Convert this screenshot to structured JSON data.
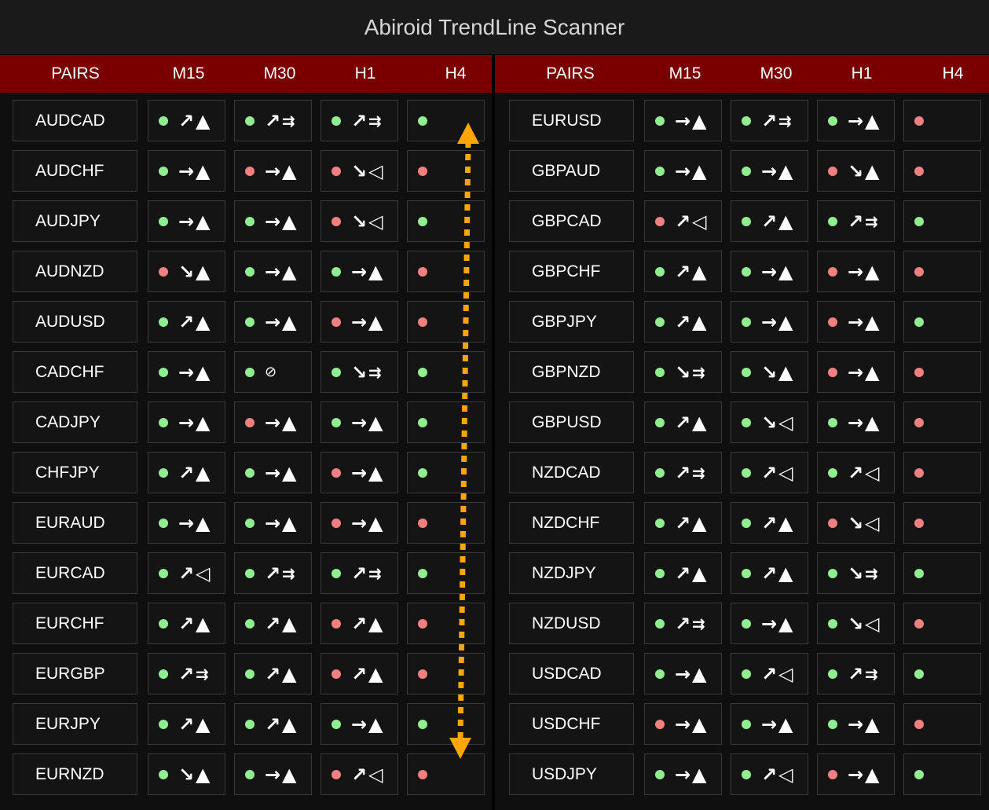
{
  "title": "Abiroid TrendLine Scanner",
  "colors": {
    "bullish": "#90ee90",
    "bearish": "#f08080",
    "header": "#7a0000",
    "annotation_arrow": "#ffa500"
  },
  "glyphs": {
    "up": "↗",
    "right": "→",
    "down": "↘",
    "triangle": "▲",
    "hollow": "◁",
    "double": "⇉",
    "no": "⊘"
  },
  "headers": [
    "PAIRS",
    "M15",
    "M30",
    "H1",
    "H4"
  ],
  "left_table": [
    {
      "pair": "AUDCAD",
      "cells": [
        {
          "dot": "g",
          "arrow": "up",
          "shape": "triangle"
        },
        {
          "dot": "g",
          "arrow": "up",
          "shape": "double"
        },
        {
          "dot": "g",
          "arrow": "up",
          "shape": "double"
        },
        {
          "dot": "g"
        }
      ]
    },
    {
      "pair": "AUDCHF",
      "cells": [
        {
          "dot": "g",
          "arrow": "right",
          "shape": "triangle"
        },
        {
          "dot": "r",
          "arrow": "right",
          "shape": "triangle"
        },
        {
          "dot": "r",
          "arrow": "down",
          "shape": "hollow"
        },
        {
          "dot": "r"
        }
      ]
    },
    {
      "pair": "AUDJPY",
      "cells": [
        {
          "dot": "g",
          "arrow": "right",
          "shape": "triangle"
        },
        {
          "dot": "g",
          "arrow": "right",
          "shape": "triangle"
        },
        {
          "dot": "r",
          "arrow": "down",
          "shape": "hollow"
        },
        {
          "dot": "g"
        }
      ]
    },
    {
      "pair": "AUDNZD",
      "cells": [
        {
          "dot": "r",
          "arrow": "down",
          "shape": "triangle"
        },
        {
          "dot": "g",
          "arrow": "right",
          "shape": "triangle"
        },
        {
          "dot": "g",
          "arrow": "right",
          "shape": "triangle"
        },
        {
          "dot": "r"
        }
      ]
    },
    {
      "pair": "AUDUSD",
      "cells": [
        {
          "dot": "g",
          "arrow": "up",
          "shape": "triangle"
        },
        {
          "dot": "g",
          "arrow": "right",
          "shape": "triangle"
        },
        {
          "dot": "r",
          "arrow": "right",
          "shape": "triangle"
        },
        {
          "dot": "r"
        }
      ]
    },
    {
      "pair": "CADCHF",
      "cells": [
        {
          "dot": "g",
          "arrow": "right",
          "shape": "triangle"
        },
        {
          "dot": "g",
          "arrow": "no",
          "shape": ""
        },
        {
          "dot": "g",
          "arrow": "down",
          "shape": "double"
        },
        {
          "dot": "g"
        }
      ]
    },
    {
      "pair": "CADJPY",
      "cells": [
        {
          "dot": "g",
          "arrow": "right",
          "shape": "triangle"
        },
        {
          "dot": "r",
          "arrow": "right",
          "shape": "triangle"
        },
        {
          "dot": "g",
          "arrow": "right",
          "shape": "triangle"
        },
        {
          "dot": "g"
        }
      ]
    },
    {
      "pair": "CHFJPY",
      "cells": [
        {
          "dot": "g",
          "arrow": "up",
          "shape": "triangle"
        },
        {
          "dot": "g",
          "arrow": "right",
          "shape": "triangle"
        },
        {
          "dot": "r",
          "arrow": "right",
          "shape": "triangle"
        },
        {
          "dot": "g"
        }
      ]
    },
    {
      "pair": "EURAUD",
      "cells": [
        {
          "dot": "g",
          "arrow": "right",
          "shape": "triangle"
        },
        {
          "dot": "g",
          "arrow": "right",
          "shape": "triangle"
        },
        {
          "dot": "r",
          "arrow": "right",
          "shape": "triangle"
        },
        {
          "dot": "r"
        }
      ]
    },
    {
      "pair": "EURCAD",
      "cells": [
        {
          "dot": "g",
          "arrow": "up",
          "shape": "hollow"
        },
        {
          "dot": "g",
          "arrow": "up",
          "shape": "double"
        },
        {
          "dot": "g",
          "arrow": "up",
          "shape": "double"
        },
        {
          "dot": "g"
        }
      ]
    },
    {
      "pair": "EURCHF",
      "cells": [
        {
          "dot": "g",
          "arrow": "up",
          "shape": "triangle"
        },
        {
          "dot": "g",
          "arrow": "up",
          "shape": "triangle"
        },
        {
          "dot": "r",
          "arrow": "up",
          "shape": "triangle"
        },
        {
          "dot": "r"
        }
      ]
    },
    {
      "pair": "EURGBP",
      "cells": [
        {
          "dot": "g",
          "arrow": "up",
          "shape": "double"
        },
        {
          "dot": "g",
          "arrow": "up",
          "shape": "triangle"
        },
        {
          "dot": "r",
          "arrow": "up",
          "shape": "triangle"
        },
        {
          "dot": "r"
        }
      ]
    },
    {
      "pair": "EURJPY",
      "cells": [
        {
          "dot": "g",
          "arrow": "up",
          "shape": "triangle"
        },
        {
          "dot": "g",
          "arrow": "up",
          "shape": "triangle"
        },
        {
          "dot": "g",
          "arrow": "right",
          "shape": "triangle"
        },
        {
          "dot": "g"
        }
      ]
    },
    {
      "pair": "EURNZD",
      "cells": [
        {
          "dot": "g",
          "arrow": "down",
          "shape": "triangle"
        },
        {
          "dot": "g",
          "arrow": "right",
          "shape": "triangle"
        },
        {
          "dot": "r",
          "arrow": "up",
          "shape": "hollow"
        },
        {
          "dot": "r"
        }
      ]
    }
  ],
  "right_table": [
    {
      "pair": "EURUSD",
      "cells": [
        {
          "dot": "g",
          "arrow": "right",
          "shape": "triangle"
        },
        {
          "dot": "g",
          "arrow": "up",
          "shape": "double"
        },
        {
          "dot": "g",
          "arrow": "right",
          "shape": "triangle"
        },
        {
          "dot": "r"
        }
      ]
    },
    {
      "pair": "GBPAUD",
      "cells": [
        {
          "dot": "g",
          "arrow": "right",
          "shape": "triangle"
        },
        {
          "dot": "g",
          "arrow": "right",
          "shape": "triangle"
        },
        {
          "dot": "r",
          "arrow": "down",
          "shape": "triangle"
        },
        {
          "dot": "r"
        }
      ]
    },
    {
      "pair": "GBPCAD",
      "cells": [
        {
          "dot": "r",
          "arrow": "up",
          "shape": "hollow"
        },
        {
          "dot": "g",
          "arrow": "up",
          "shape": "triangle"
        },
        {
          "dot": "g",
          "arrow": "up",
          "shape": "double"
        },
        {
          "dot": "g"
        }
      ]
    },
    {
      "pair": "GBPCHF",
      "cells": [
        {
          "dot": "g",
          "arrow": "up",
          "shape": "triangle"
        },
        {
          "dot": "g",
          "arrow": "right",
          "shape": "triangle"
        },
        {
          "dot": "r",
          "arrow": "right",
          "shape": "triangle"
        },
        {
          "dot": "r"
        }
      ]
    },
    {
      "pair": "GBPJPY",
      "cells": [
        {
          "dot": "g",
          "arrow": "up",
          "shape": "triangle"
        },
        {
          "dot": "g",
          "arrow": "right",
          "shape": "triangle"
        },
        {
          "dot": "r",
          "arrow": "right",
          "shape": "triangle"
        },
        {
          "dot": "g"
        }
      ]
    },
    {
      "pair": "GBPNZD",
      "cells": [
        {
          "dot": "g",
          "arrow": "down",
          "shape": "double"
        },
        {
          "dot": "g",
          "arrow": "down",
          "shape": "triangle"
        },
        {
          "dot": "r",
          "arrow": "right",
          "shape": "triangle"
        },
        {
          "dot": "r"
        }
      ]
    },
    {
      "pair": "GBPUSD",
      "cells": [
        {
          "dot": "g",
          "arrow": "up",
          "shape": "triangle"
        },
        {
          "dot": "g",
          "arrow": "down",
          "shape": "hollow"
        },
        {
          "dot": "g",
          "arrow": "right",
          "shape": "triangle"
        },
        {
          "dot": "r"
        }
      ]
    },
    {
      "pair": "NZDCAD",
      "cells": [
        {
          "dot": "g",
          "arrow": "up",
          "shape": "double"
        },
        {
          "dot": "g",
          "arrow": "up",
          "shape": "hollow"
        },
        {
          "dot": "g",
          "arrow": "up",
          "shape": "hollow"
        },
        {
          "dot": "r"
        }
      ]
    },
    {
      "pair": "NZDCHF",
      "cells": [
        {
          "dot": "g",
          "arrow": "up",
          "shape": "triangle"
        },
        {
          "dot": "g",
          "arrow": "up",
          "shape": "triangle"
        },
        {
          "dot": "r",
          "arrow": "down",
          "shape": "hollow"
        },
        {
          "dot": "r"
        }
      ]
    },
    {
      "pair": "NZDJPY",
      "cells": [
        {
          "dot": "g",
          "arrow": "up",
          "shape": "triangle"
        },
        {
          "dot": "g",
          "arrow": "up",
          "shape": "triangle"
        },
        {
          "dot": "g",
          "arrow": "down",
          "shape": "double"
        },
        {
          "dot": "g"
        }
      ]
    },
    {
      "pair": "NZDUSD",
      "cells": [
        {
          "dot": "g",
          "arrow": "up",
          "shape": "double"
        },
        {
          "dot": "g",
          "arrow": "right",
          "shape": "triangle"
        },
        {
          "dot": "g",
          "arrow": "down",
          "shape": "hollow"
        },
        {
          "dot": "r"
        }
      ]
    },
    {
      "pair": "USDCAD",
      "cells": [
        {
          "dot": "g",
          "arrow": "right",
          "shape": "triangle"
        },
        {
          "dot": "g",
          "arrow": "up",
          "shape": "hollow"
        },
        {
          "dot": "g",
          "arrow": "up",
          "shape": "double"
        },
        {
          "dot": "g"
        }
      ]
    },
    {
      "pair": "USDCHF",
      "cells": [
        {
          "dot": "r",
          "arrow": "right",
          "shape": "triangle"
        },
        {
          "dot": "g",
          "arrow": "right",
          "shape": "triangle"
        },
        {
          "dot": "g",
          "arrow": "right",
          "shape": "triangle"
        },
        {
          "dot": "r"
        }
      ]
    },
    {
      "pair": "USDJPY",
      "cells": [
        {
          "dot": "g",
          "arrow": "right",
          "shape": "triangle"
        },
        {
          "dot": "g",
          "arrow": "up",
          "shape": "hollow"
        },
        {
          "dot": "r",
          "arrow": "right",
          "shape": "triangle"
        },
        {
          "dot": "g"
        }
      ]
    }
  ]
}
